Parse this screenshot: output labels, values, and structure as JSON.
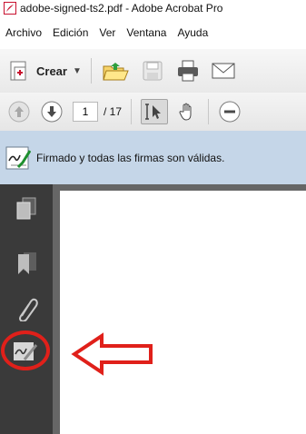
{
  "window": {
    "title": "adobe-signed-ts2.pdf - Adobe Acrobat Pro"
  },
  "menu": {
    "items": [
      "Archivo",
      "Edición",
      "Ver",
      "Ventana",
      "Ayuda"
    ]
  },
  "toolbar": {
    "create_label": "Crear",
    "icons": [
      "create-pdf-icon",
      "open-folder-icon",
      "save-disk-icon",
      "print-icon",
      "email-icon"
    ]
  },
  "navigation": {
    "page_current": "1",
    "page_total": "/ 17",
    "icons": [
      "previous-page-icon",
      "next-page-icon",
      "select-tool-icon",
      "hand-tool-icon",
      "zoom-out-icon"
    ]
  },
  "signature_bar": {
    "message": "Firmado y todas las firmas son válidas.",
    "icon": "signature-pen-icon"
  },
  "left_panel": {
    "icons": [
      "page-thumbnails-icon",
      "bookmarks-icon",
      "attachments-icon",
      "signatures-icon"
    ]
  },
  "annotation": {
    "color": "#e0201a",
    "shapes": [
      "highlight-circle",
      "pointer-arrow"
    ]
  }
}
